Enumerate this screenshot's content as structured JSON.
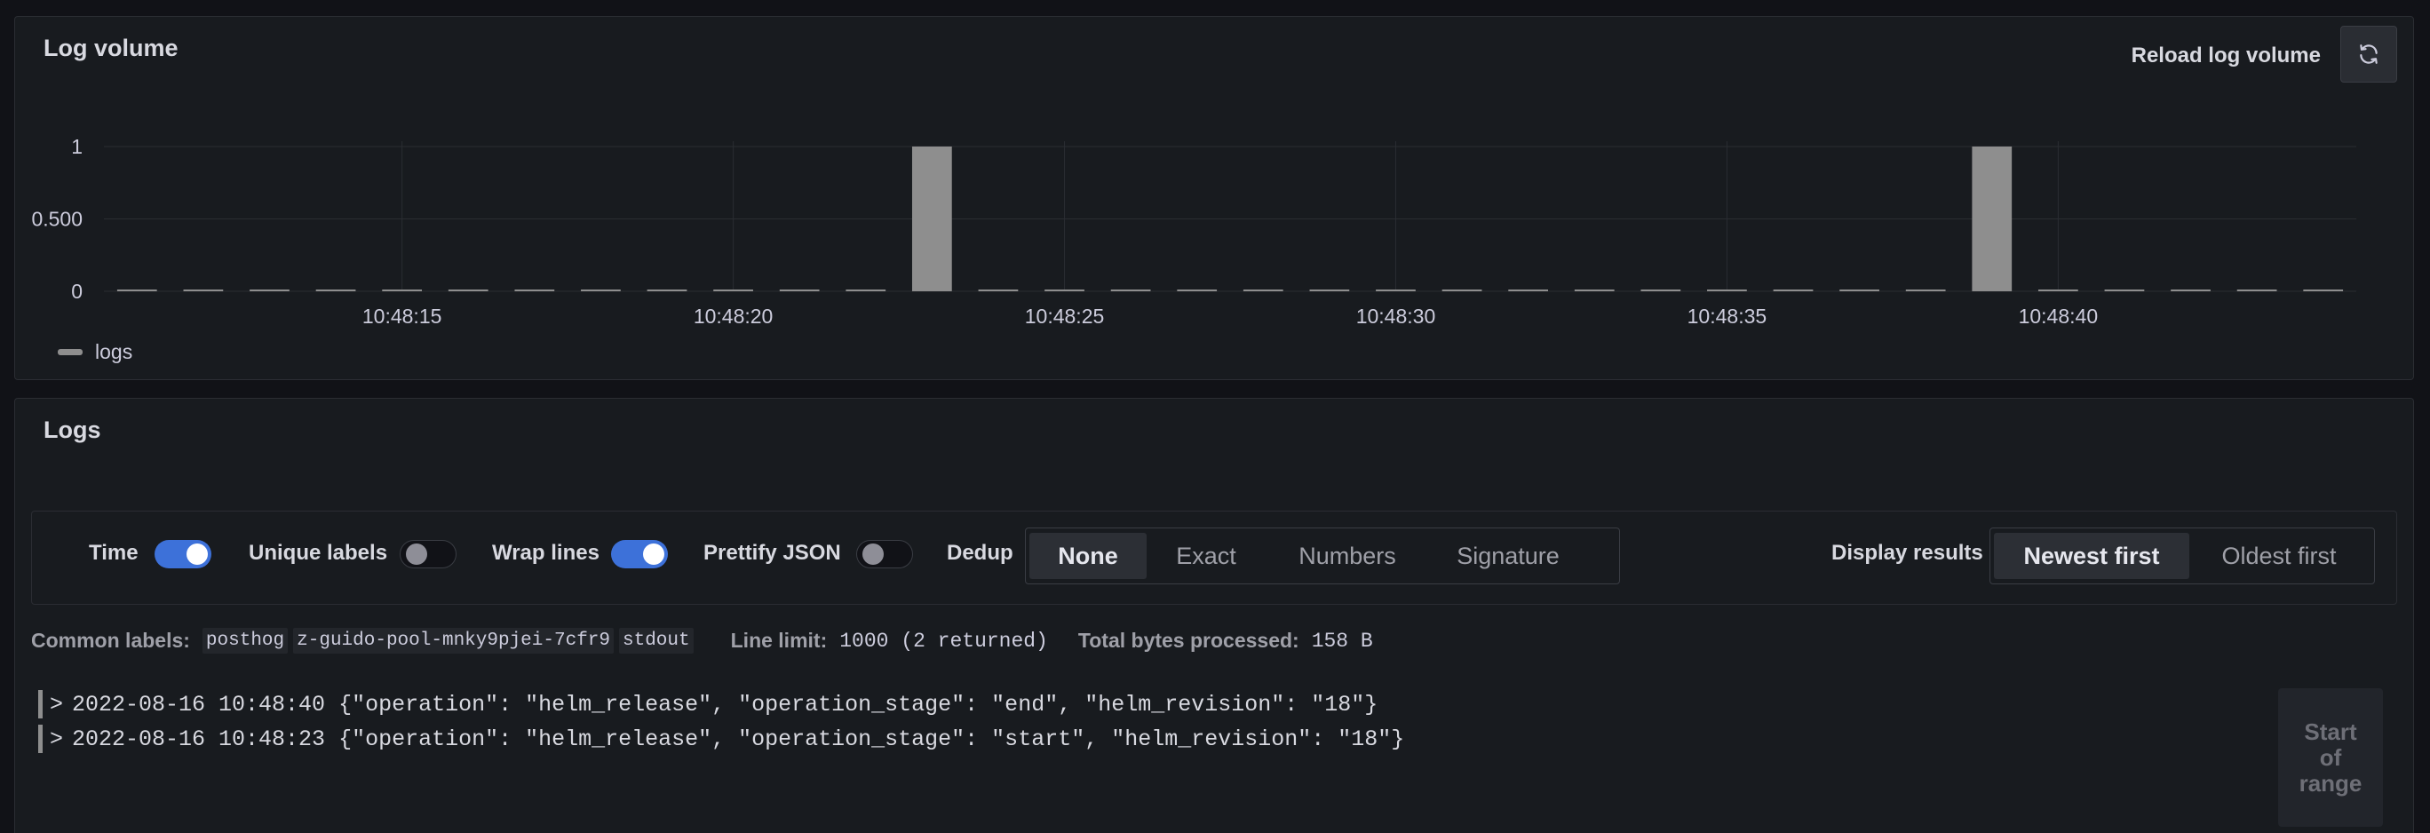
{
  "log_volume": {
    "title": "Log volume",
    "reload_label": "Reload log volume",
    "reload_icon": "sync-icon",
    "legend": {
      "label": "logs",
      "color": "#8e8e8e"
    }
  },
  "chart_data": {
    "type": "bar",
    "x": [
      "10:48:11",
      "10:48:12",
      "10:48:13",
      "10:48:14",
      "10:48:15",
      "10:48:16",
      "10:48:17",
      "10:48:18",
      "10:48:19",
      "10:48:20",
      "10:48:21",
      "10:48:22",
      "10:48:23",
      "10:48:24",
      "10:48:25",
      "10:48:26",
      "10:48:27",
      "10:48:28",
      "10:48:29",
      "10:48:30",
      "10:48:31",
      "10:48:32",
      "10:48:33",
      "10:48:34",
      "10:48:35",
      "10:48:36",
      "10:48:37",
      "10:48:38",
      "10:48:39",
      "10:48:40",
      "10:48:41",
      "10:48:42",
      "10:48:43",
      "10:48:44"
    ],
    "series": [
      {
        "name": "logs",
        "values": [
          0,
          0,
          0,
          0,
          0,
          0,
          0,
          0,
          0,
          0,
          0,
          0,
          1,
          0,
          0,
          0,
          0,
          0,
          0,
          0,
          0,
          0,
          0,
          0,
          0,
          0,
          0,
          0,
          1,
          0,
          0,
          0,
          0,
          0
        ]
      }
    ],
    "x_ticks": [
      "10:48:15",
      "10:48:20",
      "10:48:25",
      "10:48:30",
      "10:48:35",
      "10:48:40"
    ],
    "y_ticks": [
      "0",
      "0.500",
      "1"
    ],
    "ylim": [
      0,
      1
    ],
    "grid": true,
    "legend_position": "bottom-left"
  },
  "logs": {
    "title": "Logs",
    "controls": {
      "time": {
        "label": "Time",
        "on": true
      },
      "unique_labels": {
        "label": "Unique labels",
        "on": false
      },
      "wrap_lines": {
        "label": "Wrap lines",
        "on": true
      },
      "prettify_json": {
        "label": "Prettify JSON",
        "on": false
      },
      "dedup": {
        "label": "Dedup",
        "options": [
          "None",
          "Exact",
          "Numbers",
          "Signature"
        ],
        "selected": "None"
      },
      "display_results": {
        "label": "Display results",
        "options": [
          "Newest first",
          "Oldest first"
        ],
        "selected": "Newest first"
      }
    },
    "meta": {
      "common_labels_key": "Common labels:",
      "common_labels": [
        "posthog",
        "z-guido-pool-mnky9pjei-7cfr9",
        "stdout"
      ],
      "line_limit_key": "Line limit:",
      "line_limit_value": "1000 (2 returned)",
      "bytes_key": "Total bytes processed:",
      "bytes_value": "158 B"
    },
    "lines": [
      {
        "text": "2022-08-16 10:48:40 {\"operation\": \"helm_release\", \"operation_stage\": \"end\", \"helm_revision\": \"18\"}"
      },
      {
        "text": "2022-08-16 10:48:23 {\"operation\": \"helm_release\", \"operation_stage\": \"start\", \"helm_revision\": \"18\"}"
      }
    ],
    "chevron": ">",
    "start_of_range": {
      "lines": [
        "Start",
        "of",
        "range"
      ]
    }
  }
}
